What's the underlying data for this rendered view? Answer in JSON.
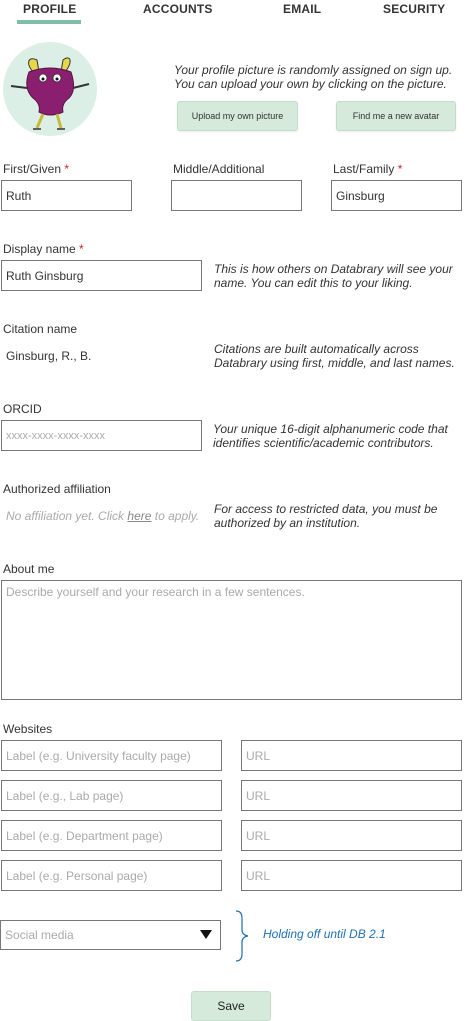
{
  "tabs": [
    "PROFILE",
    "ACCOUNTS",
    "EMAIL",
    "SECURITY"
  ],
  "avatar_note": "Your profile picture is randomly assigned on sign up. You can upload your own by clicking on the picture.",
  "avatar_note_line1": "Your profile picture is randomly assigned on sign up.",
  "avatar_note_line2": "You can upload your own by clicking on the picture.",
  "upload_button": "Upload my own picture",
  "new_avatar_button": "Find me a new avatar",
  "name": {
    "first_label": "First/Given",
    "middle_label": "Middle/Additional",
    "last_label": "Last/Family",
    "first_value": "Ruth",
    "middle_value": "",
    "last_value": "Ginsburg",
    "required_mark": "*"
  },
  "display_name": {
    "label": "Display name",
    "value": "Ruth Ginsburg",
    "note_line1": "This is how others on Databrary will see your",
    "note_line2": "name. You can edit this to your liking."
  },
  "citation": {
    "label": "Citation name",
    "value": "Ginsburg, R., B.",
    "note_line1": "Citations are built automatically across",
    "note_line2": "Databrary using first, middle, and last names."
  },
  "orcid": {
    "label": "ORCID",
    "placeholder": "xxxx-xxxx-xxxx-xxxx",
    "note_line1": "Your unique 16-digit alphanumeric code that",
    "note_line2": "identifies scientific/academic contributors."
  },
  "affiliation": {
    "label": "Authorized affiliation",
    "empty_prefix": "No affiliation yet. Click ",
    "link": "here",
    "empty_suffix": " to apply.",
    "note_line1": "For access to restricted data, you must be",
    "note_line2": "authorized by an institution."
  },
  "about": {
    "label": "About me",
    "placeholder": "Describe yourself and your research in a few sentences."
  },
  "websites": {
    "label": "Websites",
    "rows": [
      {
        "label_placeholder": "Label (e.g. University faculty page)",
        "url_placeholder": "URL"
      },
      {
        "label_placeholder": "Label (e.g., Lab page)",
        "url_placeholder": "URL"
      },
      {
        "label_placeholder": "Label (e.g. Department page)",
        "url_placeholder": "URL"
      },
      {
        "label_placeholder": "Label (e.g. Personal page)",
        "url_placeholder": "URL"
      }
    ]
  },
  "social": {
    "placeholder": "Social media",
    "note": "Holding off until DB 2.1"
  },
  "save_button": "Save",
  "colors": {
    "accent": "#7fbfa8",
    "button_bg": "#d5eadb",
    "required": "#cc2222",
    "note_blue": "#1f6fb5"
  }
}
